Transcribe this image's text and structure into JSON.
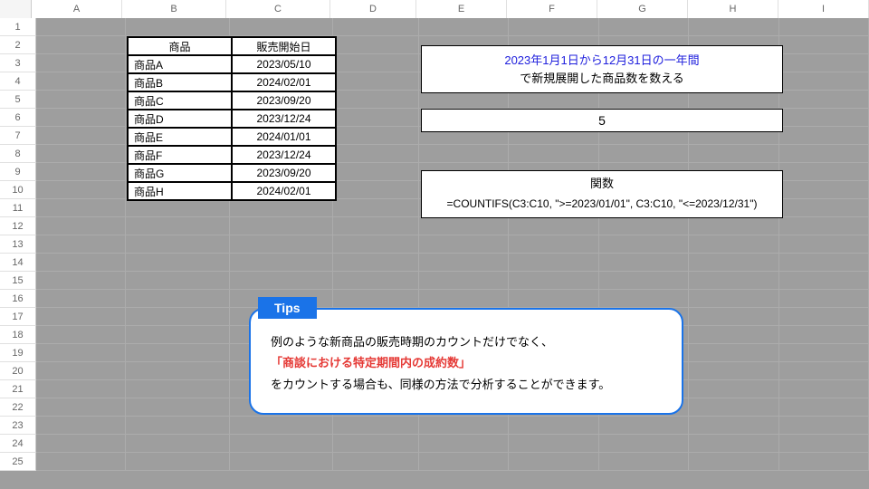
{
  "columns": [
    "A",
    "B",
    "C",
    "D",
    "E",
    "F",
    "G",
    "H",
    "I"
  ],
  "rowCount": 25,
  "table": {
    "headers": [
      "商品",
      "販売開始日"
    ],
    "rows": [
      {
        "name": "商品A",
        "date": "2023/05/10"
      },
      {
        "name": "商品B",
        "date": "2024/02/01"
      },
      {
        "name": "商品C",
        "date": "2023/09/20"
      },
      {
        "name": "商品D",
        "date": "2023/12/24"
      },
      {
        "name": "商品E",
        "date": "2024/01/01"
      },
      {
        "name": "商品F",
        "date": "2023/12/24"
      },
      {
        "name": "商品G",
        "date": "2023/09/20"
      },
      {
        "name": "商品H",
        "date": "2024/02/01"
      }
    ]
  },
  "info": {
    "highlight": "2023年1月1日から12月31日の一年間",
    "line2": "で新規展開した商品数を数える"
  },
  "count_result": "5",
  "function": {
    "header": "関数",
    "formula": "=COUNTIFS(C3:C10, \">=2023/01/01\", C3:C10, \"<=2023/12/31\")"
  },
  "tips": {
    "badge": "Tips",
    "line1": "例のような新商品の販売時期のカウントだけでなく、",
    "red": "「商談における特定期間内の成約数」",
    "line3": "をカウントする場合も、同様の方法で分析することができます。"
  }
}
